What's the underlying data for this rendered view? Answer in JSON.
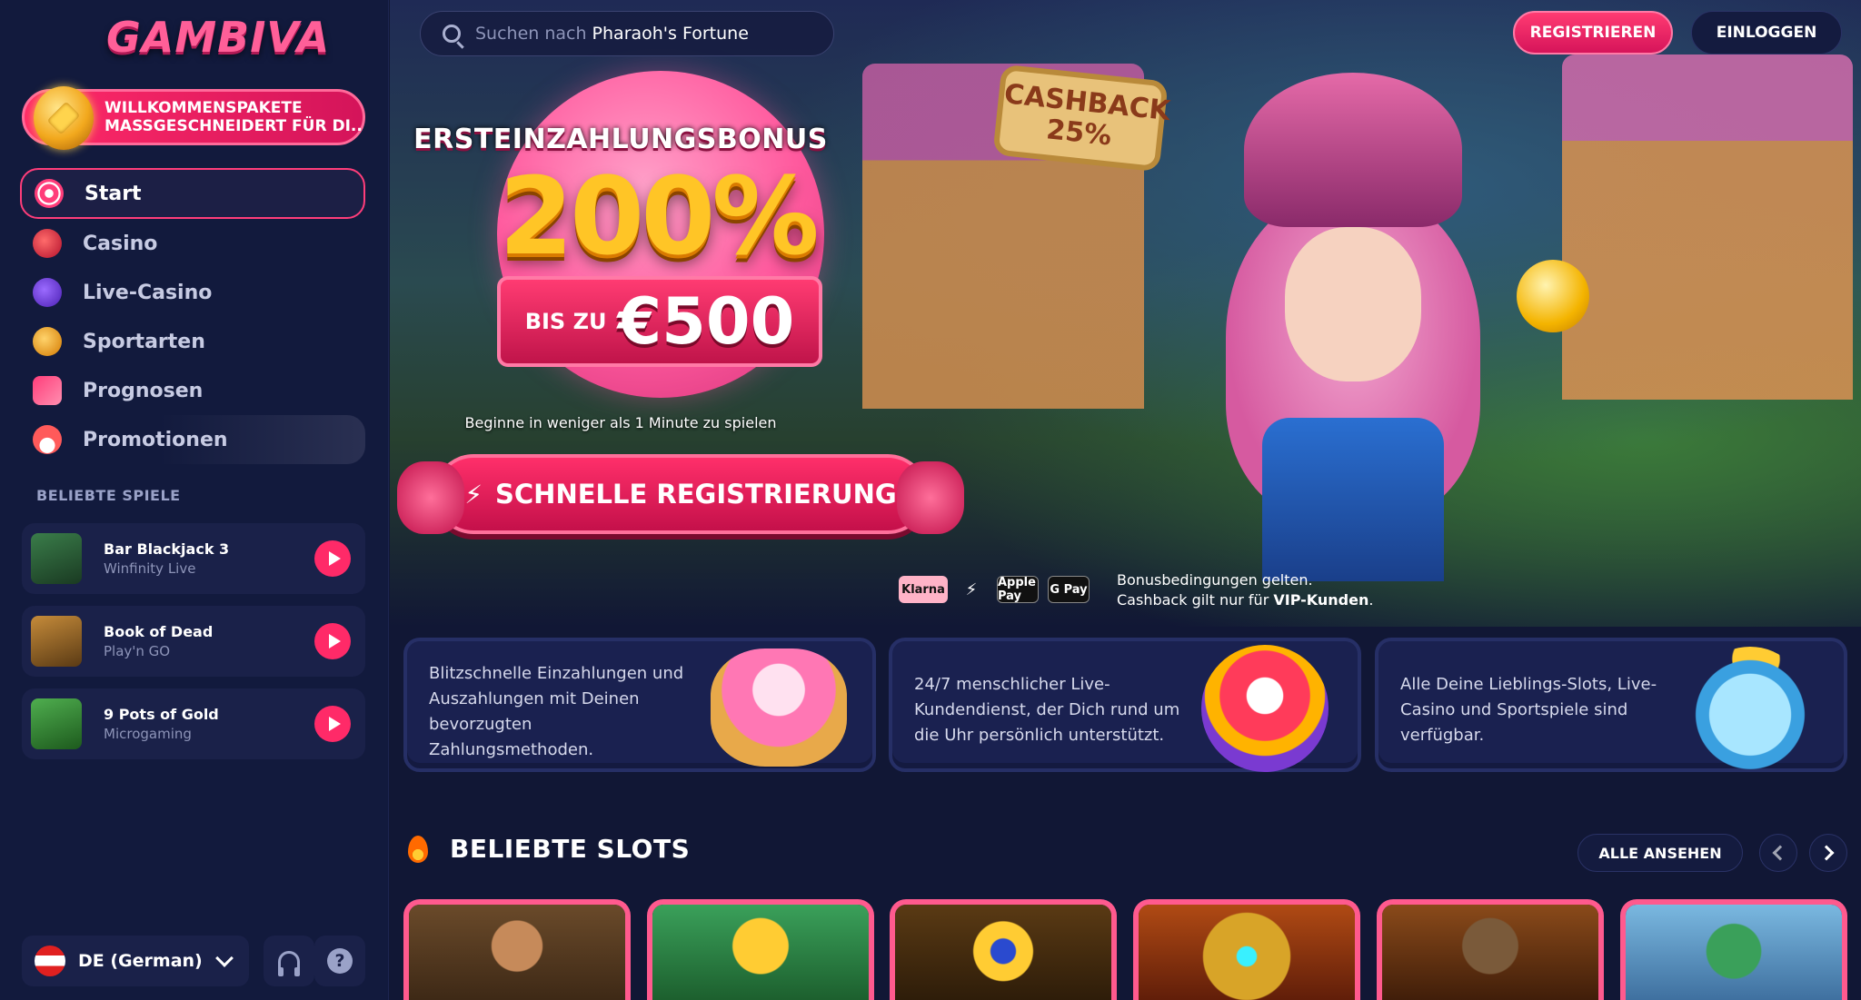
{
  "brand": {
    "logo_text": "GAMBIVA",
    "accent_color": "#ff2a68",
    "background_color": "#111735"
  },
  "sidebar": {
    "welcome_banner": "WILLKOMMENSPAKETE MASSGESCHNEIDERT FÜR DI..",
    "nav_items": [
      {
        "label": "Start",
        "icon": "swirl-candy-icon",
        "active": true
      },
      {
        "label": "Casino",
        "icon": "cherry-icon"
      },
      {
        "label": "Live-Casino",
        "icon": "poker-chip-icon"
      },
      {
        "label": "Sportarten",
        "icon": "medal-icon"
      },
      {
        "label": "Prognosen",
        "icon": "chart-trend-icon"
      },
      {
        "label": "Promotionen",
        "icon": "cake-icon"
      }
    ],
    "popular_games_label": "BELIEBTE SPIELE",
    "popular_games": [
      {
        "name": "Bar Blackjack 3",
        "provider": "Winfinity Live"
      },
      {
        "name": "Book of Dead",
        "provider": "Play'n GO"
      },
      {
        "name": "9 Pots of Gold",
        "provider": "Microgaming"
      }
    ],
    "language": "DE (German)",
    "support_icon": "headset-icon",
    "help_icon": "question-icon"
  },
  "topbar": {
    "search_hint": "Suchen nach",
    "search_game": "Pharaoh's Fortune",
    "register_label": "REGISTRIEREN",
    "login_label": "EINLOGGEN"
  },
  "hero": {
    "bonus_title": "ERSTEINZAHLUNGSBONUS",
    "bonus_percent": "200%",
    "bonus_prefix": "BIS ZU",
    "bonus_amount": "€500",
    "cashback_sign": "CASHBACK 25%",
    "begin_text": "Beginne in weniger als 1 Minute zu spielen",
    "cta_label": "SCHNELLE REGISTRIERUNG",
    "payment_methods": [
      "Klarna",
      "Instant",
      "Apple Pay",
      "G Pay"
    ],
    "terms_line1": "Bonusbedingungen gelten.",
    "terms_line2_prefix": "Cashback gilt nur für",
    "terms_line2_bold": "VIP-Kunden",
    "terms_line2_suffix": "."
  },
  "features": [
    {
      "text": "Blitzschnelle Einzahlungen und Auszahlungen mit Deinen bevorzugten Zahlungsmethoden."
    },
    {
      "text": "24/7 menschlicher Live-Kundendienst, der Dich rund um die Uhr persönlich unterstützt."
    },
    {
      "text": "Alle Deine Lieblings-Slots, Live-Casino und Sportspiele sind verfügbar."
    }
  ],
  "slots": {
    "title": "BELIEBTE SLOTS",
    "see_all_label": "ALLE ANSEHEN"
  }
}
